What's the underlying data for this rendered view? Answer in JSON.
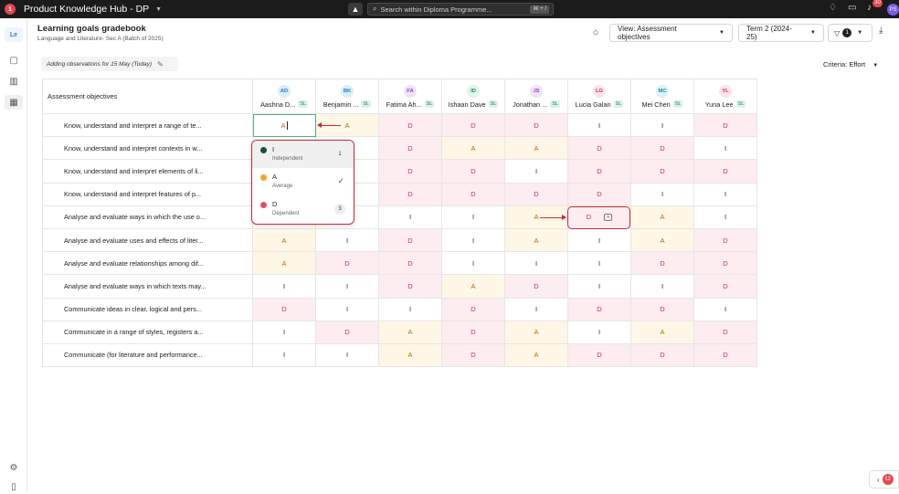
{
  "topbar": {
    "logo_text": "1",
    "app_name": "Product Knowledge Hub - DP",
    "search_placeholder": "Search within Diploma Programme...",
    "search_shortcut": "⌘ + /",
    "notification_count": "30",
    "user_initials": "PS"
  },
  "rail": {
    "course_badge": "Le"
  },
  "header": {
    "title": "Learning goals gradebook",
    "subtitle": "Language and Literature- Sec A (Batch of 2025)",
    "view_label": "View: Assessment objectives",
    "term_label": "Term 2 (2024-25)",
    "filter_count": "1"
  },
  "toolbar": {
    "observation_text": "Adding observations for 15 May (Today)",
    "criteria_label": "Criteria: Effort"
  },
  "grid": {
    "objectives_header": "Assessment objectives",
    "sl_tag": "SL",
    "students": [
      {
        "initials": "AD",
        "name": "Aashna D...",
        "color": "#d9eefb",
        "text_color": "#2a7ab8"
      },
      {
        "initials": "BK",
        "name": "Benjamin ...",
        "color": "#d9eefb",
        "text_color": "#2a7ab8"
      },
      {
        "initials": "FA",
        "name": "Fatima Ah...",
        "color": "#f1e2fb",
        "text_color": "#9544c4"
      },
      {
        "initials": "ID",
        "name": "Ishaan Dave",
        "color": "#dff5ea",
        "text_color": "#2c8a5c"
      },
      {
        "initials": "JS",
        "name": "Jonathan ...",
        "color": "#f1e2fb",
        "text_color": "#9544c4"
      },
      {
        "initials": "LG",
        "name": "Lucia Galan",
        "color": "#fde3ea",
        "text_color": "#c2335a"
      },
      {
        "initials": "MC",
        "name": "Mei Chen",
        "color": "#d9f2f7",
        "text_color": "#2a8aa0"
      },
      {
        "initials": "YL",
        "name": "Yuna Lee",
        "color": "#fde3ea",
        "text_color": "#c2335a"
      }
    ],
    "rows": [
      {
        "objective": "Know, understand and interpret a range of te...",
        "grades": [
          "A",
          "A",
          "D",
          "D",
          "D",
          "I",
          "I",
          "D"
        ]
      },
      {
        "objective": "Know, understand and interpret contexts in w...",
        "grades": [
          "",
          "",
          "D",
          "A",
          "A",
          "D",
          "D",
          "I"
        ]
      },
      {
        "objective": "Know, understand and interpret elements of li...",
        "grades": [
          "",
          "",
          "D",
          "D",
          "I",
          "D",
          "D",
          "D"
        ]
      },
      {
        "objective": "Know, understand and interpret features of p...",
        "grades": [
          "",
          "",
          "D",
          "D",
          "D",
          "D",
          "I",
          "I"
        ]
      },
      {
        "objective": "Analyse and evaluate ways in which the use o...",
        "grades": [
          "",
          "",
          "I",
          "I",
          "A",
          "D",
          "A",
          "I"
        ]
      },
      {
        "objective": "Analyse and evaluate uses and effects of liter...",
        "grades": [
          "A",
          "I",
          "D",
          "I",
          "A",
          "I",
          "A",
          "D"
        ]
      },
      {
        "objective": "Analyse and evaluate relationships among dif...",
        "grades": [
          "A",
          "D",
          "D",
          "I",
          "I",
          "I",
          "D",
          "D"
        ]
      },
      {
        "objective": "Analyse and evaluate ways in which texts may...",
        "grades": [
          "I",
          "I",
          "D",
          "A",
          "D",
          "I",
          "I",
          "D"
        ]
      },
      {
        "objective": "Communicate ideas in clear, logical and pers...",
        "grades": [
          "D",
          "I",
          "I",
          "D",
          "I",
          "D",
          "D",
          "I"
        ]
      },
      {
        "objective": "Communicate in a range of styles, registers a...",
        "grades": [
          "I",
          "D",
          "A",
          "D",
          "A",
          "I",
          "A",
          "D"
        ]
      },
      {
        "objective": "Communicate (for literature and performance...",
        "grades": [
          "I",
          "I",
          "A",
          "D",
          "A",
          "D",
          "D",
          "D"
        ]
      }
    ]
  },
  "grade_menu": {
    "options": [
      {
        "code": "I",
        "desc": "Independent",
        "count": "1",
        "color": "#1f4d3b"
      },
      {
        "code": "A",
        "desc": "Average",
        "count": "",
        "color": "#f0a430"
      },
      {
        "code": "D",
        "desc": "Dependent",
        "count": "3",
        "color": "#e05068"
      }
    ]
  },
  "bottom_panel": {
    "count": "12"
  }
}
